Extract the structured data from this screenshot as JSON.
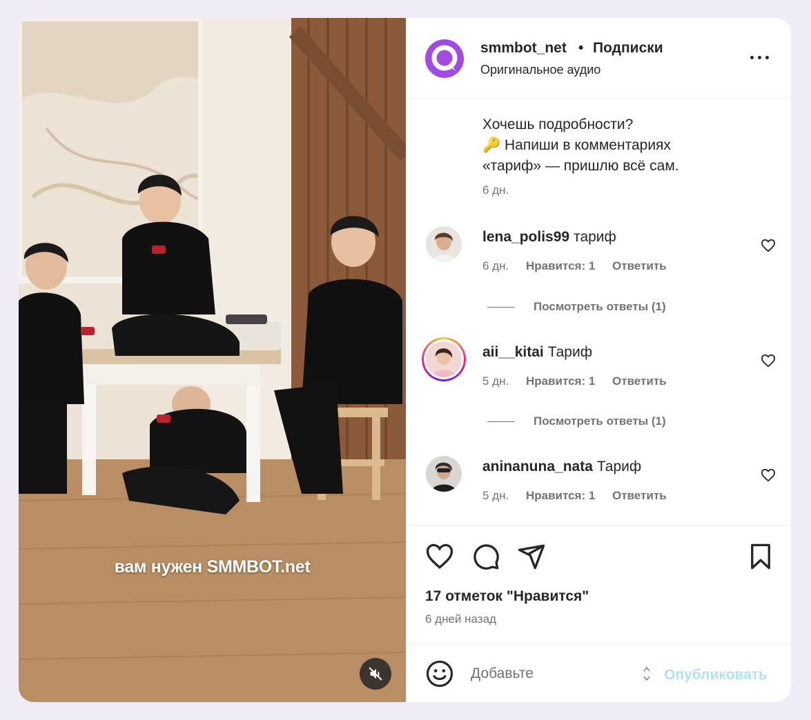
{
  "media": {
    "overlay_text": "вам нужен SMMBOT.net",
    "mute_icon": "volume-muted-icon"
  },
  "header": {
    "username": "smmbot_net",
    "separator": "•",
    "follow_label": "Подписки",
    "audio_label": "Оригинальное аудио",
    "more_icon": "more-horizontal-icon"
  },
  "caption": {
    "line1": "Хочешь подробности?",
    "line2": "🔑 Напиши в комментариях",
    "line3": "«тариф» — пришлю всё сам.",
    "time": "6 дн."
  },
  "comments": [
    {
      "username": "lena_polis99",
      "text": "тариф",
      "time": "6 дн.",
      "likes": "Нравится: 1",
      "reply": "Ответить",
      "view_replies": "Посмотреть ответы (1)"
    },
    {
      "username": "aii__kitai",
      "text": "Тариф",
      "time": "5 дн.",
      "likes": "Нравится: 1",
      "reply": "Ответить",
      "view_replies": "Посмотреть ответы (1)"
    },
    {
      "username": "aninanuna_nata",
      "text": "Тариф",
      "time": "5 дн.",
      "likes": "Нравится: 1",
      "reply": "Ответить"
    }
  ],
  "actions": {
    "likes_count": "17 отметок \"Нравится\"",
    "posted_ago": "6 дней назад"
  },
  "composer": {
    "placeholder": "Добавьте",
    "publish_label": "Опубликовать"
  },
  "colors": {
    "page_bg": "#efecf8",
    "brand_purple": "#a24be0",
    "publish_disabled": "#b2dffc",
    "muted_text": "#737373"
  }
}
